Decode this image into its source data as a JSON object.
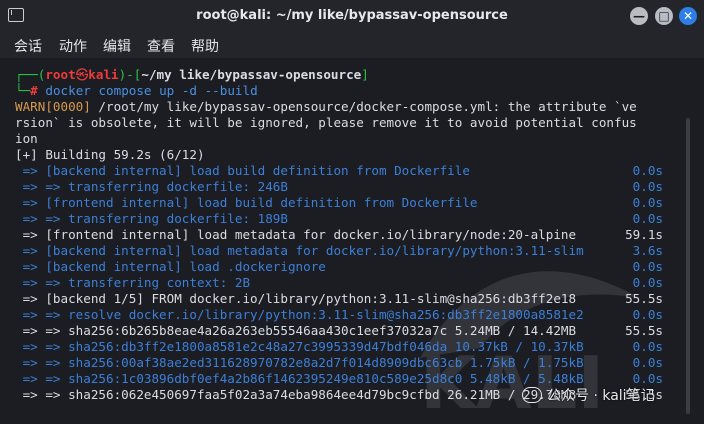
{
  "window": {
    "title": "root@kali: ~/my like/bypassav-opensource",
    "buttons": {
      "minimize": "—",
      "maximize": "□",
      "close": "✕"
    }
  },
  "menu": [
    "会话",
    "动作",
    "编辑",
    "查看",
    "帮助"
  ],
  "prompt": {
    "top_left": "┌──(",
    "user": "root",
    "at": "㉿",
    "host": "kali",
    "mid": ")-[",
    "path": "~/my like/bypassav-opensource",
    "end": "]",
    "bottom_left": "└─",
    "hash": "#",
    "cmd": "docker",
    "args": " compose up -d --build"
  },
  "output": {
    "warn_tag": "WARN[0000]",
    "warn_1": " /root/my like/bypassav-opensource/docker-compose.yml: the attribute `ve",
    "warn_2": "rsion` is obsolete, it will be ignored, please remove it to avoid potential confus",
    "warn_3": "ion",
    "building": "[+] Building 59.2s (6/12)",
    "steps": [
      {
        "text": " => [backend internal] load build definition from Dockerfile",
        "time": "0.0s",
        "tone": "blue"
      },
      {
        "text": " => => transferring dockerfile: 246B",
        "time": "0.0s",
        "tone": "blue"
      },
      {
        "text": " => [frontend internal] load build definition from Dockerfile",
        "time": "0.0s",
        "tone": "blue"
      },
      {
        "text": " => => transferring dockerfile: 189B",
        "time": "0.0s",
        "tone": "blue"
      },
      {
        "text": " => [frontend internal] load metadata for docker.io/library/node:20-alpine",
        "time": "59.1s",
        "tone": "white"
      },
      {
        "text": " => [backend internal] load metadata for docker.io/library/python:3.11-slim",
        "time": "3.6s",
        "tone": "blue"
      },
      {
        "text": " => [backend internal] load .dockerignore",
        "time": "0.0s",
        "tone": "blue"
      },
      {
        "text": " => => transferring context: 2B",
        "time": "0.0s",
        "tone": "blue"
      },
      {
        "text": " => [backend 1/5] FROM docker.io/library/python:3.11-slim@sha256:db3ff2e18",
        "time": "55.5s",
        "tone": "white"
      },
      {
        "text": " => => resolve docker.io/library/python:3.11-slim@sha256:db3ff2e1800a8581e2",
        "time": "0.0s",
        "tone": "blue"
      },
      {
        "text": " => => sha256:6b265b8eae4a26a263eb55546aa430c1eef37032a7c 5.24MB / 14.42MB",
        "time": "55.5s",
        "tone": "white"
      },
      {
        "text": " => => sha256:db3ff2e1800a8581e2c48a27c3995339d47bdf046da 10.37kB / 10.37kB",
        "time": "0.0s",
        "tone": "blue"
      },
      {
        "text": " => => sha256:00af38ae2ed311628970782e8a2d7f014d8909dbc63cb 1.75kB / 1.75kB",
        "time": "0.0s",
        "tone": "blue"
      },
      {
        "text": " => => sha256:1c03896dbf0ef4a2b86f1462395249e810c589e25d8c0 5.48kB / 5.48kB",
        "time": "0.0s",
        "tone": "blue"
      },
      {
        "text": " => => sha256:062e450697faa5f02a3a74eba9864ee4d79bc9cfbd 26.21MB / 29.78MB",
        "time": "55.5s",
        "tone": "white"
      }
    ]
  },
  "watermark": {
    "text": "公众号 · kali笔记"
  },
  "colors": {
    "background": "#1b1d23",
    "titlebar": "#23252b",
    "blue": "#3d7fd6",
    "white": "#d9dde3",
    "warn": "#d59a4c",
    "prompt_green": "#2bc240",
    "prompt_red": "#ee3b3b",
    "close_button": "#2f7ee6"
  }
}
